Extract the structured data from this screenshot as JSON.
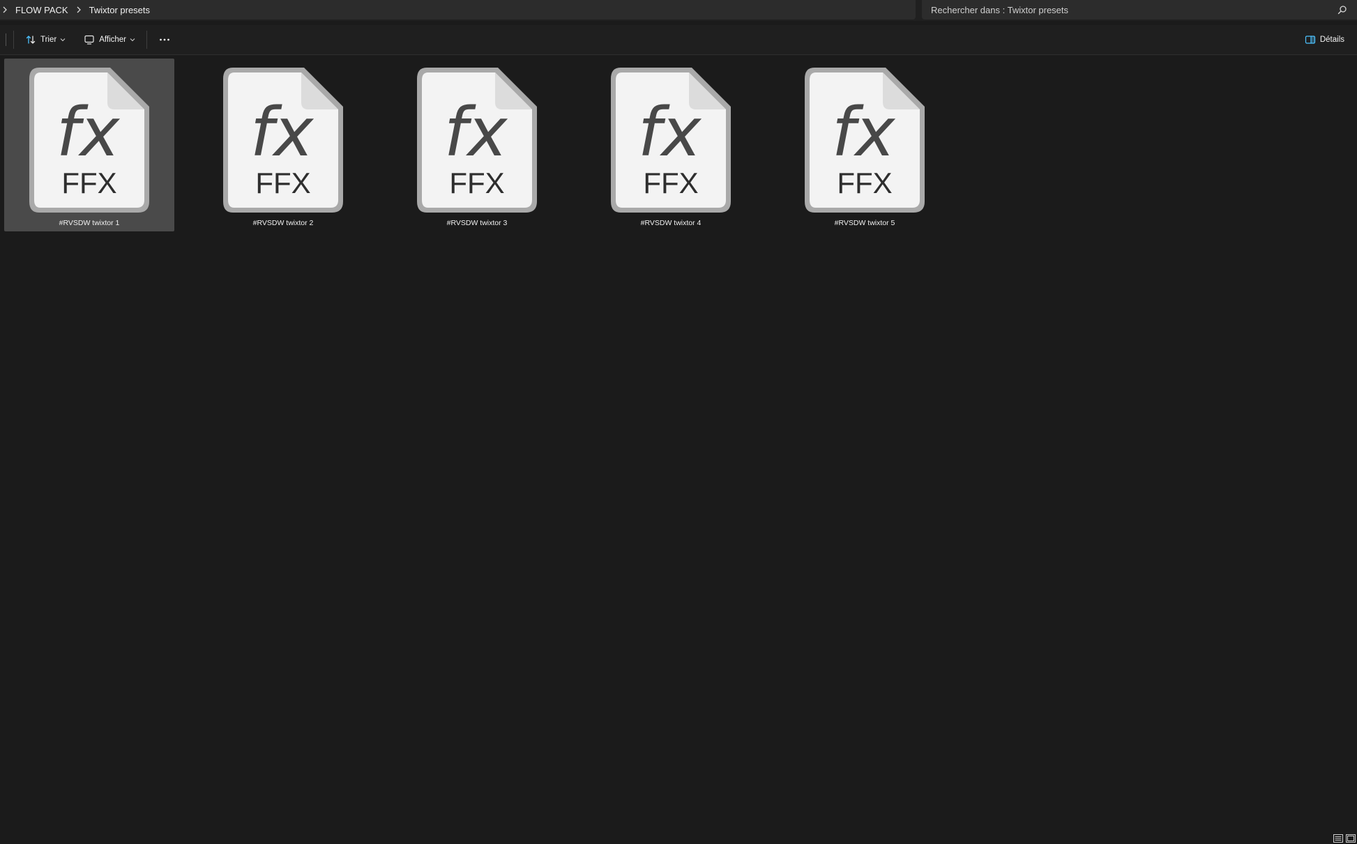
{
  "breadcrumb": {
    "items": [
      "FLOW PACK",
      "Twixtor presets"
    ]
  },
  "search": {
    "placeholder": "Rechercher dans : Twixtor presets"
  },
  "command_bar": {
    "sort_label": "Trier",
    "view_label": "Afficher",
    "details_label": "Détails"
  },
  "files": [
    {
      "name": "#RVSDW twixtor 1",
      "icon_text": "fx",
      "type_label": "FFX",
      "selected": true
    },
    {
      "name": "#RVSDW twixtor 2",
      "icon_text": "fx",
      "type_label": "FFX",
      "selected": false
    },
    {
      "name": "#RVSDW twixtor 3",
      "icon_text": "fx",
      "type_label": "FFX",
      "selected": false
    },
    {
      "name": "#RVSDW twixtor 4",
      "icon_text": "fx",
      "type_label": "FFX",
      "selected": false
    },
    {
      "name": "#RVSDW twixtor 5",
      "icon_text": "fx",
      "type_label": "FFX",
      "selected": false
    }
  ],
  "colors": {
    "background": "#1b1b1b",
    "bar": "#2c2c2c",
    "selection": "#4a4a4a",
    "accent": "#4cc2ff",
    "icon_page": "#f3f3f3",
    "icon_border": "#a9a9a9",
    "icon_glyph": "#484848"
  }
}
